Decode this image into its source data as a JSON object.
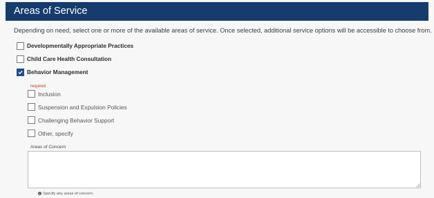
{
  "section": {
    "title": "Areas of Service",
    "intro": "Depending on need, select one or more of the available areas of service. Once selected, additional service options will be accessible to choose from."
  },
  "service_areas": [
    {
      "label": "Developmentally Appropriate Practices",
      "checked": false
    },
    {
      "label": "Child Care Health Consultation",
      "checked": false
    },
    {
      "label": "Behavior Management",
      "checked": true
    }
  ],
  "behavior_management": {
    "required_text": "required",
    "options": [
      {
        "label": "Inclusion",
        "checked": false
      },
      {
        "label": "Suspension and Expulsion Policies",
        "checked": false
      },
      {
        "label": "Challenging Behavior Support",
        "checked": false
      },
      {
        "label": "Other, specify",
        "checked": false
      }
    ]
  },
  "areas_of_concern": {
    "label": "Areas of Concern",
    "value": "",
    "help_text": "Specify any areas of concern."
  },
  "icons": {
    "checkmark": "check-icon",
    "info": "info-icon",
    "resize": "resize-grip-icon"
  },
  "colors": {
    "header_bg": "#163c6e",
    "checked_bg": "#1f4f8c",
    "required": "#c0392b"
  }
}
